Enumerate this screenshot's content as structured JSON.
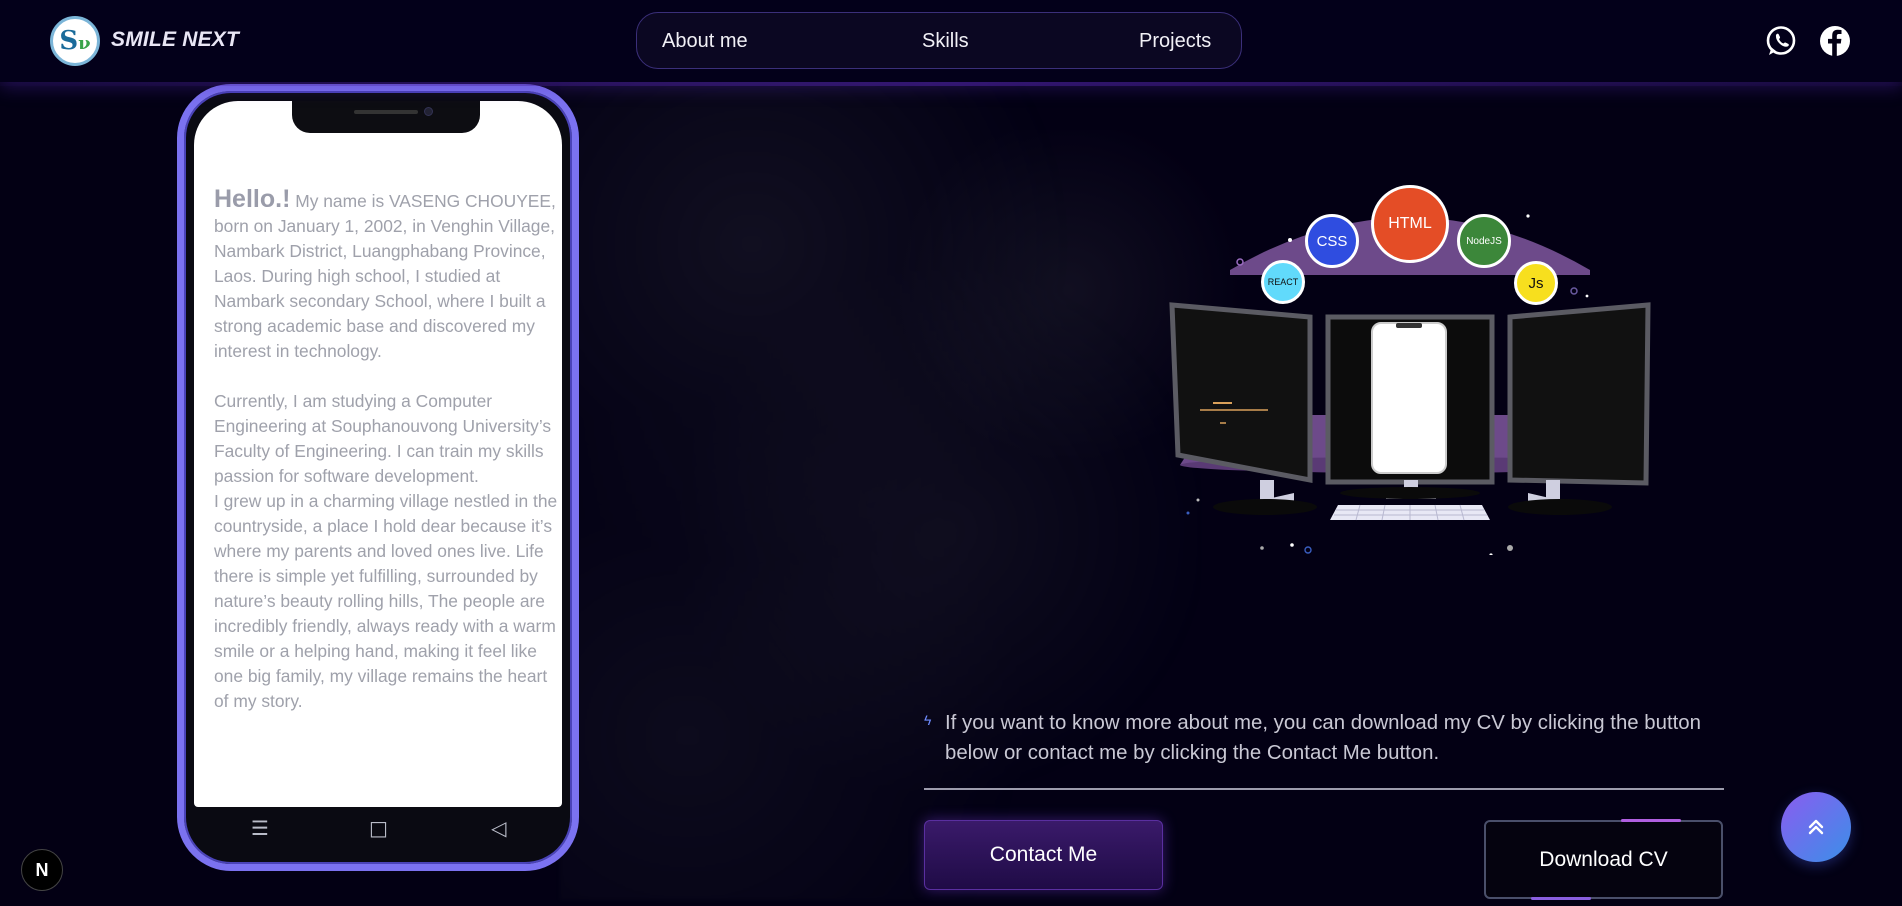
{
  "header": {
    "brand": "SMILE NEXT",
    "logo_letters": "S",
    "nav": [
      "About me",
      "Skills",
      "Projects"
    ],
    "social": [
      "whatsapp-icon",
      "facebook-icon"
    ]
  },
  "phone": {
    "hello": "Hello.!",
    "paragraph1": " My name is VASENG CHOUYEE, born on January 1, 2002, in Venghin Village, Nambark District, Luangphabang Province, Laos. During high school, I studied at Nambark secondary School, where I built a strong academic base and discovered my interest in technology.",
    "paragraph2": "Currently, I am studying a Computer Engineering at Souphanouvong University’s Faculty of Engineering. I can train my skills passion for software development.",
    "paragraph3": "I grew up in a charming village nestled in the countryside, a place I hold dear because it’s where my parents and loved ones live. Life there is simple yet fulfilling, surrounded by nature’s beauty rolling hills, The people are incredibly friendly, always ready with a warm smile or a helping hand, making it feel like one big family, my village remains the heart of my story.",
    "soft_keys": [
      "☰",
      "□",
      "◁"
    ]
  },
  "illustration": {
    "badges": [
      "HTML",
      "CSS",
      "NodeJS",
      "REACT",
      "Js"
    ],
    "colors": {
      "html": "#e44d26",
      "css": "#2f4de0",
      "node": "#3c873a",
      "react": "#61dafb",
      "js": "#f7df1e",
      "desk": "#6d4a8a"
    }
  },
  "cta": {
    "text": "If you want to know more about me, you can download my CV by clicking the button below or contact me by clicking the Contact Me button.",
    "contact_label": "Contact Me",
    "download_label": "Download CV",
    "scroll_top_icon": "double-chevron-up-icon",
    "next_badge": "N"
  }
}
